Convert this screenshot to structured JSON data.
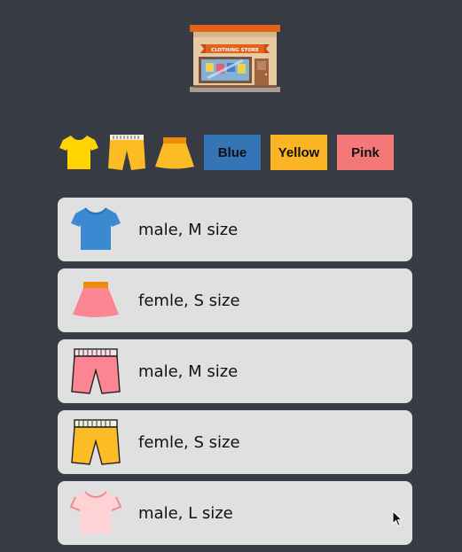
{
  "store": {
    "sign_text": "CLOTHING STORE"
  },
  "toolbar": {
    "icons": [
      {
        "name": "tshirt-icon",
        "color": "#ffd400"
      },
      {
        "name": "pants-icon",
        "color": "#fbbc25"
      },
      {
        "name": "skirt-icon",
        "color": "#fbbc25"
      }
    ],
    "buttons": [
      {
        "label": "Blue",
        "color": "#3375b7"
      },
      {
        "label": "Yellow",
        "color": "#fbb524"
      },
      {
        "label": "Pink",
        "color": "#f57878"
      }
    ]
  },
  "items": [
    {
      "icon": "tshirt-icon",
      "color": "blue",
      "label": "male, M size"
    },
    {
      "icon": "skirt-icon",
      "color": "pink",
      "label": "femle, S size"
    },
    {
      "icon": "pants-icon",
      "color": "pink",
      "label": "male, M size"
    },
    {
      "icon": "pants-icon",
      "color": "yellow",
      "label": "femle, S size"
    },
    {
      "icon": "tshirt-icon",
      "color": "light-pink",
      "label": "male, L size"
    }
  ]
}
